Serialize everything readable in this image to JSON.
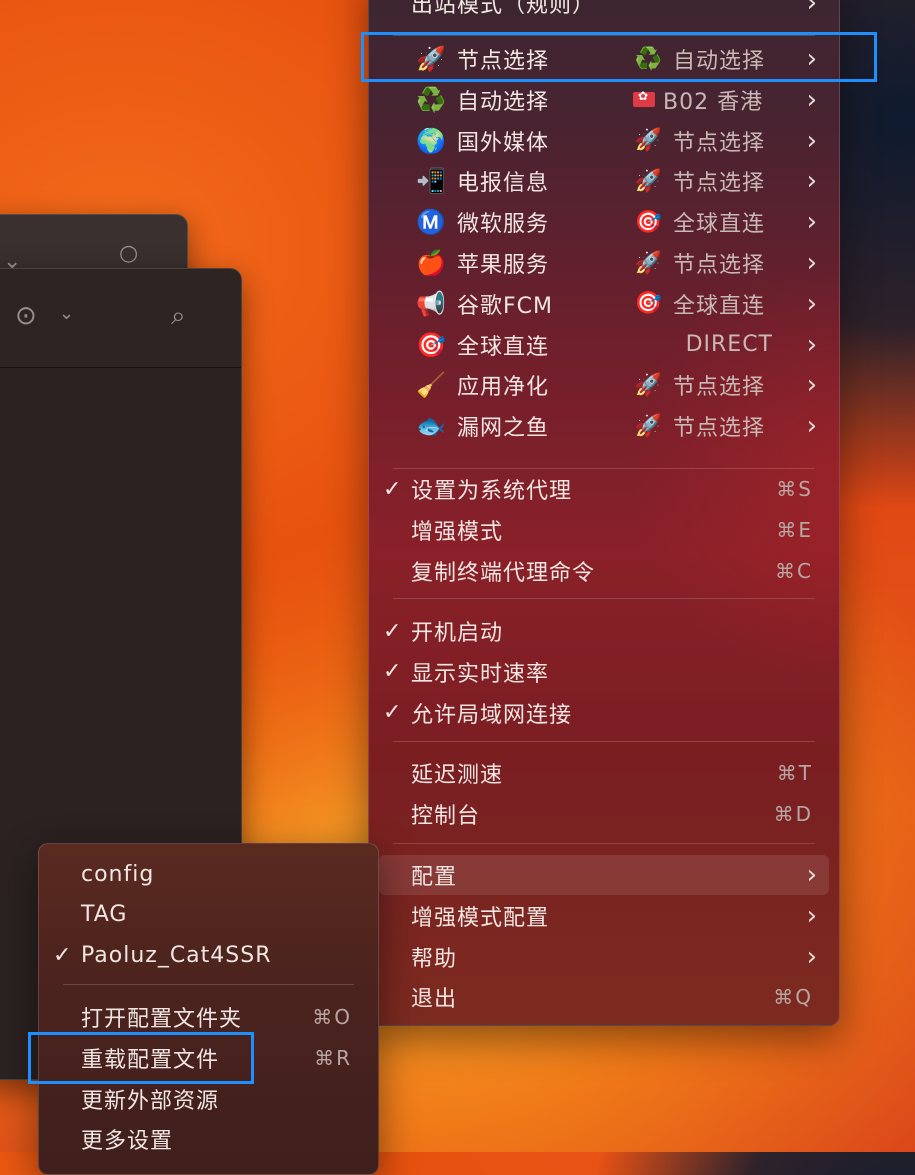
{
  "main_menu": {
    "top_item": {
      "label": "出站模式（规则）"
    },
    "proxy_groups": [
      {
        "name": "节点选择",
        "icon": "🚀",
        "icon_name": "rocket-icon",
        "value": "自动选择",
        "value_icon": "♻️",
        "value_icon_name": "recycle-icon"
      },
      {
        "name": "自动选择",
        "icon": "♻️",
        "icon_name": "recycle-icon",
        "value": "B02 香港",
        "value_icon": "",
        "value_icon_name": "hong-kong-flag-icon"
      },
      {
        "name": "国外媒体",
        "icon": "🌍",
        "icon_name": "globe-icon",
        "value": "节点选择",
        "value_icon": "🚀",
        "value_icon_name": "rocket-icon"
      },
      {
        "name": "电报信息",
        "icon": "📲",
        "icon_name": "phone-icon",
        "value": "节点选择",
        "value_icon": "🚀",
        "value_icon_name": "rocket-icon"
      },
      {
        "name": "微软服务",
        "icon": "Ⓜ️",
        "icon_name": "m-circle-icon",
        "value": "全球直连",
        "value_icon": "🎯",
        "value_icon_name": "target-icon"
      },
      {
        "name": "苹果服务",
        "icon": "🍎",
        "icon_name": "apple-icon",
        "value": "节点选择",
        "value_icon": "🚀",
        "value_icon_name": "rocket-icon"
      },
      {
        "name": "谷歌FCM",
        "icon": "📢",
        "icon_name": "megaphone-icon",
        "value": "全球直连",
        "value_icon": "🎯",
        "value_icon_name": "target-icon"
      },
      {
        "name": "全球直连",
        "icon": "🎯",
        "icon_name": "target-icon",
        "value": "DIRECT",
        "value_icon": "",
        "value_icon_name": ""
      },
      {
        "name": "应用净化",
        "icon": "🧹",
        "icon_name": "broom-icon",
        "value": "节点选择",
        "value_icon": "🚀",
        "value_icon_name": "rocket-icon"
      },
      {
        "name": "漏网之鱼",
        "icon": "🐟",
        "icon_name": "fish-icon",
        "value": "节点选择",
        "value_icon": "🚀",
        "value_icon_name": "rocket-icon"
      }
    ],
    "system": [
      {
        "label": "设置为系统代理",
        "checked": true,
        "check": "✓",
        "shortcut": "⌘S"
      },
      {
        "label": "增强模式",
        "checked": false,
        "check": "",
        "shortcut": "⌘E"
      },
      {
        "label": "复制终端代理命令",
        "checked": false,
        "check": "",
        "shortcut": "⌘C"
      }
    ],
    "toggles": [
      {
        "label": "开机启动",
        "checked": true,
        "check": "✓"
      },
      {
        "label": "显示实时速率",
        "checked": true,
        "check": "✓"
      },
      {
        "label": "允许局域网连接",
        "checked": true,
        "check": "✓"
      }
    ],
    "tools": [
      {
        "label": "延迟测速",
        "shortcut": "⌘T"
      },
      {
        "label": "控制台",
        "shortcut": "⌘D"
      }
    ],
    "bottom": [
      {
        "label": "配置",
        "submenu": true,
        "highlighted": true
      },
      {
        "label": "增强模式配置",
        "submenu": true
      },
      {
        "label": "帮助",
        "submenu": true
      },
      {
        "label": "退出",
        "shortcut": "⌘Q"
      }
    ]
  },
  "config_submenu": {
    "profiles": [
      {
        "label": "config",
        "checked": false,
        "check": ""
      },
      {
        "label": "TAG",
        "checked": false,
        "check": ""
      },
      {
        "label": "Paoluz_Cat4SSR",
        "checked": true,
        "check": "✓"
      }
    ],
    "actions": [
      {
        "label": "打开配置文件夹",
        "shortcut": "⌘O"
      },
      {
        "label": "重载配置文件",
        "shortcut": "⌘R"
      },
      {
        "label": "更新外部资源",
        "shortcut": ""
      },
      {
        "label": "更多设置",
        "shortcut": ""
      }
    ]
  },
  "chevron": "›",
  "colors": {
    "annotation_box": "#1e8fff",
    "menu_text": "#f1e6e2",
    "value_text": "#c9b8b5"
  }
}
